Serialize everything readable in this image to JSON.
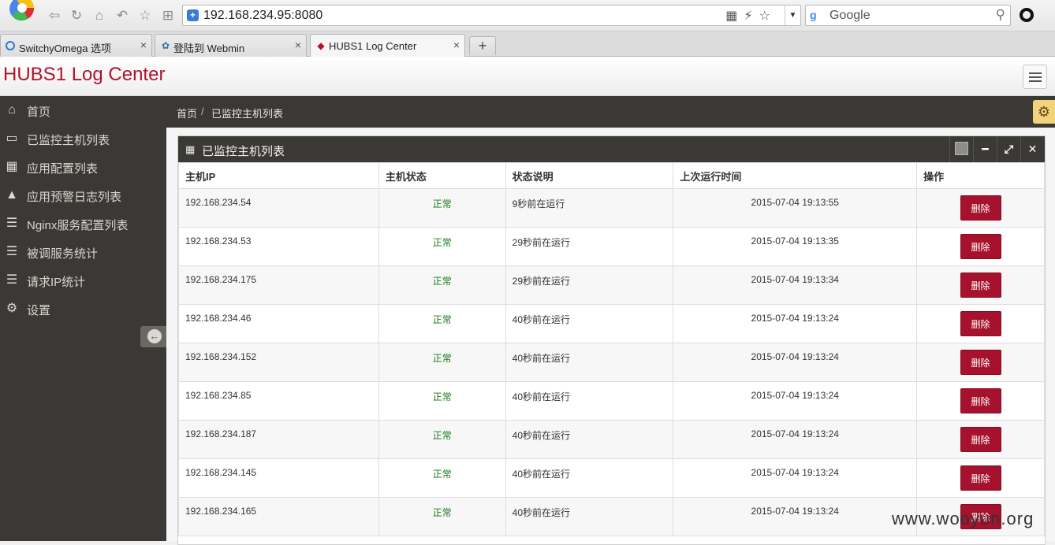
{
  "browser": {
    "url": "192.168.234.95:8080",
    "search_placeholder": "Google",
    "tabs": [
      {
        "label": "SwitchyOmega 选项",
        "close": "×"
      },
      {
        "label": "登陆到 Webmin",
        "close": "×"
      },
      {
        "label": "HUBS1 Log Center",
        "close": "×"
      }
    ],
    "new_tab": "+"
  },
  "app": {
    "title": "HUBS1 Log Center"
  },
  "sidebar": {
    "items": [
      {
        "label": "首页",
        "icon": "home-icon"
      },
      {
        "label": "已监控主机列表",
        "icon": "monitor-icon"
      },
      {
        "label": "应用配置列表",
        "icon": "grid-icon"
      },
      {
        "label": "应用预警日志列表",
        "icon": "warning-icon"
      },
      {
        "label": "Nginx服务配置列表",
        "icon": "list-icon"
      },
      {
        "label": "被调服务统计",
        "icon": "outdent-icon"
      },
      {
        "label": "请求IP统计",
        "icon": "indent-icon"
      },
      {
        "label": "设置",
        "icon": "gear-icon"
      }
    ]
  },
  "breadcrumb": {
    "home": "首页",
    "separator": "/",
    "current": "已监控主机列表"
  },
  "widget": {
    "title": "已监控主机列表",
    "columns": [
      "主机IP",
      "主机状态",
      "状态说明",
      "上次运行时间",
      "操作"
    ],
    "rows": [
      {
        "ip": "192.168.234.54",
        "status": "正常",
        "desc": "9秒前在运行",
        "time": "2015-07-04 19:13:55",
        "action": "删除"
      },
      {
        "ip": "192.168.234.53",
        "status": "正常",
        "desc": "29秒前在运行",
        "time": "2015-07-04 19:13:35",
        "action": "删除"
      },
      {
        "ip": "192.168.234.175",
        "status": "正常",
        "desc": "29秒前在运行",
        "time": "2015-07-04 19:13:34",
        "action": "删除"
      },
      {
        "ip": "192.168.234.46",
        "status": "正常",
        "desc": "40秒前在运行",
        "time": "2015-07-04 19:13:24",
        "action": "删除"
      },
      {
        "ip": "192.168.234.152",
        "status": "正常",
        "desc": "40秒前在运行",
        "time": "2015-07-04 19:13:24",
        "action": "删除"
      },
      {
        "ip": "192.168.234.85",
        "status": "正常",
        "desc": "40秒前在运行",
        "time": "2015-07-04 19:13:24",
        "action": "删除"
      },
      {
        "ip": "192.168.234.187",
        "status": "正常",
        "desc": "40秒前在运行",
        "time": "2015-07-04 19:13:24",
        "action": "删除"
      },
      {
        "ip": "192.168.234.145",
        "status": "正常",
        "desc": "40秒前在运行",
        "time": "2015-07-04 19:13:24",
        "action": "删除"
      },
      {
        "ip": "192.168.234.165",
        "status": "正常",
        "desc": "40秒前在运行",
        "time": "2015-07-04 19:13:24",
        "action": "删除"
      }
    ]
  },
  "watermark": "www.wooyun.org",
  "colors": {
    "brand": "#b0122f",
    "sidebar_bg": "#3b3935",
    "delete_button": "#a6112d",
    "status_ok": "#1d7a1d"
  }
}
